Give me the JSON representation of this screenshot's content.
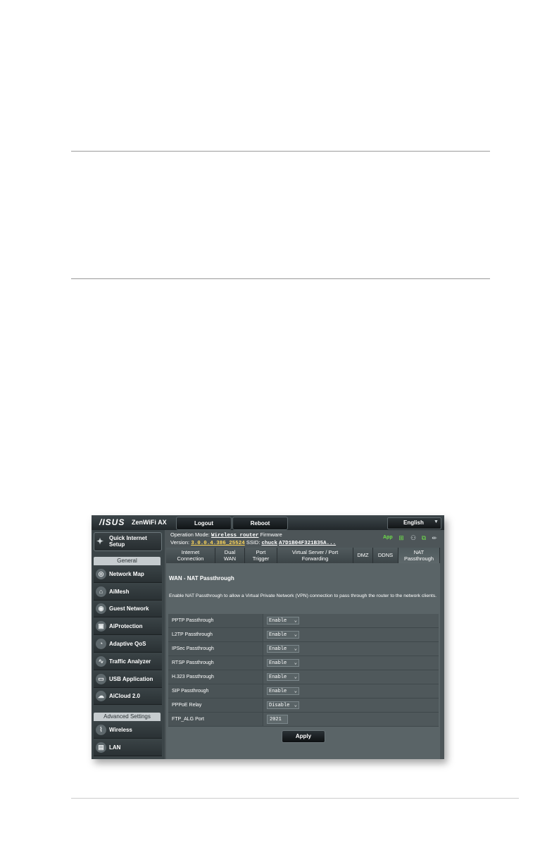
{
  "router_ui": {
    "brand": "/ISUS",
    "model": "ZenWiFi AX",
    "logout_label": "Logout",
    "reboot_label": "Reboot",
    "language": "English",
    "status": {
      "op_mode_label": "Operation Mode:",
      "op_mode_value": "Wireless router",
      "firmware_label": "Firmware",
      "version_label": "Version:",
      "version_value": "3.0.0.4.386_25524",
      "ssid_label": "SSID:",
      "ssid_value": "chuck",
      "ssid_extra": "A7D1B04F321B35A...",
      "app_label": "App"
    },
    "sidebar": {
      "quick_setup": "Quick Internet Setup",
      "general_header": "General",
      "general_items": [
        {
          "label": "Network Map",
          "icon": "network-map-icon"
        },
        {
          "label": "AiMesh",
          "icon": "aimesh-icon"
        },
        {
          "label": "Guest Network",
          "icon": "guest-network-icon"
        },
        {
          "label": "AiProtection",
          "icon": "aiprotection-icon"
        },
        {
          "label": "Adaptive QoS",
          "icon": "adaptive-qos-icon"
        },
        {
          "label": "Traffic Analyzer",
          "icon": "traffic-analyzer-icon"
        },
        {
          "label": "USB Application",
          "icon": "usb-application-icon"
        },
        {
          "label": "AiCloud 2.0",
          "icon": "aicloud-icon"
        }
      ],
      "advanced_header": "Advanced Settings",
      "advanced_items": [
        {
          "label": "Wireless",
          "icon": "wireless-icon"
        },
        {
          "label": "LAN",
          "icon": "lan-icon"
        }
      ]
    },
    "tabs": [
      {
        "line1": "Internet",
        "line2": "Connection"
      },
      {
        "line1": "Dual",
        "line2": "WAN"
      },
      {
        "line1": "Port",
        "line2": "Trigger"
      },
      {
        "line1": "Virtual Server / Port",
        "line2": "Forwarding"
      },
      {
        "line1": "DMZ",
        "line2": ""
      },
      {
        "line1": "DDNS",
        "line2": ""
      },
      {
        "line1": "NAT",
        "line2": "Passthrough"
      }
    ],
    "active_tab": "NAT Passthrough",
    "page_title": "WAN - NAT Passthrough",
    "description": "Enable NAT Passthrough to allow a Virtual Private Network (VPN) connection to pass through the router to the network clients.",
    "rows": [
      {
        "label": "PPTP Passthrough",
        "value": "Enable"
      },
      {
        "label": "L2TP Passthrough",
        "value": "Enable"
      },
      {
        "label": "IPSec Passthrough",
        "value": "Enable"
      },
      {
        "label": "RTSP Passthrough",
        "value": "Enable"
      },
      {
        "label": "H.323 Passthrough",
        "value": "Enable"
      },
      {
        "label": "SIP Passthrough",
        "value": "Enable"
      },
      {
        "label": "PPPoE Relay",
        "value": "Disable"
      }
    ],
    "ftp_alg_label": "FTP_ALG Port",
    "ftp_alg_value": "2021",
    "apply_label": "Apply",
    "colors": {
      "status_value": "#ffd85a",
      "app_green": "#6ee04a",
      "panel_bg": "#5a6467"
    }
  }
}
